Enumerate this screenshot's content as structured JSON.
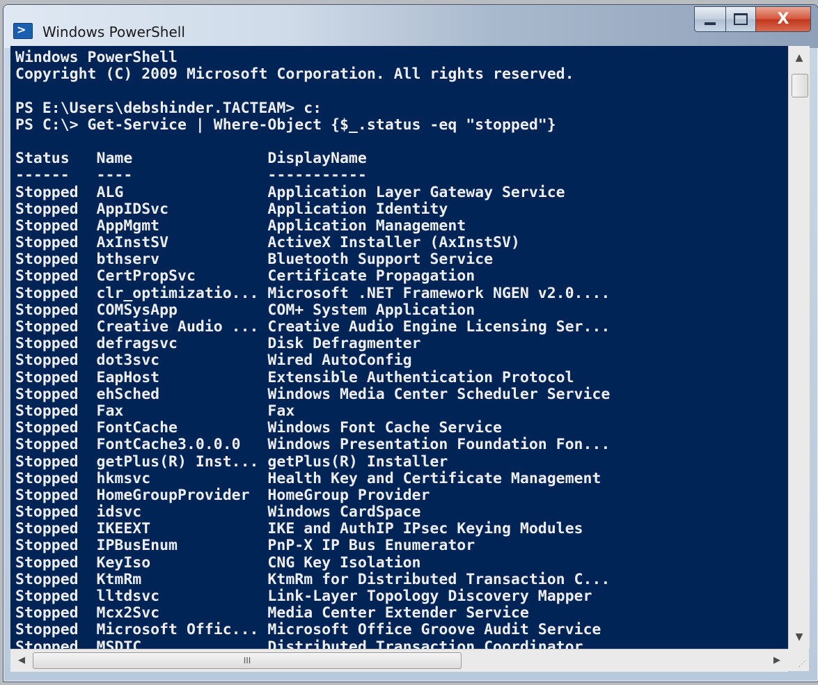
{
  "window": {
    "title": "Windows PowerShell",
    "close_label": "X",
    "icon": "powershell-icon"
  },
  "console": {
    "lines": [
      "Windows PowerShell",
      "Copyright (C) 2009 Microsoft Corporation. All rights reserved.",
      "",
      "PS E:\\Users\\debshinder.TACTEAM> c:",
      "PS C:\\> Get-Service | Where-Object {$_.status -eq \"stopped\"}",
      "",
      "Status   Name               DisplayName",
      "------   ----               -----------",
      "Stopped  ALG                Application Layer Gateway Service",
      "Stopped  AppIDSvc           Application Identity",
      "Stopped  AppMgmt            Application Management",
      "Stopped  AxInstSV           ActiveX Installer (AxInstSV)",
      "Stopped  bthserv            Bluetooth Support Service",
      "Stopped  CertPropSvc        Certificate Propagation",
      "Stopped  clr_optimizatio... Microsoft .NET Framework NGEN v2.0....",
      "Stopped  COMSysApp          COM+ System Application",
      "Stopped  Creative Audio ... Creative Audio Engine Licensing Ser...",
      "Stopped  defragsvc          Disk Defragmenter",
      "Stopped  dot3svc            Wired AutoConfig",
      "Stopped  EapHost            Extensible Authentication Protocol",
      "Stopped  ehSched            Windows Media Center Scheduler Service",
      "Stopped  Fax                Fax",
      "Stopped  FontCache          Windows Font Cache Service",
      "Stopped  FontCache3.0.0.0   Windows Presentation Foundation Fon...",
      "Stopped  getPlus(R) Inst... getPlus(R) Installer",
      "Stopped  hkmsvc             Health Key and Certificate Management",
      "Stopped  HomeGroupProvider  HomeGroup Provider",
      "Stopped  idsvc              Windows CardSpace",
      "Stopped  IKEEXT             IKE and AuthIP IPsec Keying Modules",
      "Stopped  IPBusEnum          PnP-X IP Bus Enumerator",
      "Stopped  KeyIso             CNG Key Isolation",
      "Stopped  KtmRm              KtmRm for Distributed Transaction C...",
      "Stopped  lltdsvc            Link-Layer Topology Discovery Mapper",
      "Stopped  Mcx2Svc            Media Center Extender Service",
      "Stopped  Microsoft Offic... Microsoft Office Groove Audit Service",
      "Stopped  MSDTC              Distributed Transaction Coordinator"
    ],
    "background_color": "#012456",
    "text_color": "#eeedf0"
  },
  "scrollbars": {
    "hthumb_glyph": "III",
    "up_icon": "scroll-up-arrow-icon",
    "down_icon": "scroll-down-arrow-icon",
    "left_icon": "scroll-left-arrow-icon",
    "right_icon": "scroll-right-arrow-icon"
  }
}
